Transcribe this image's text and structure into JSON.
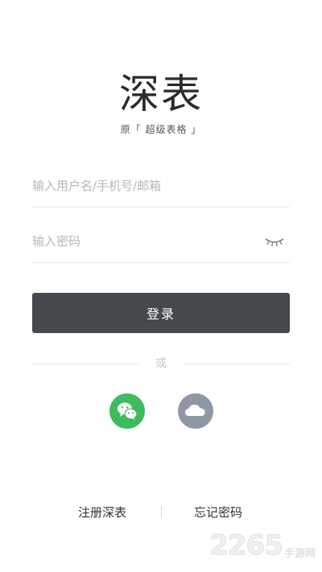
{
  "logo": {
    "mark": "深表",
    "subtitle": "原「 超级表格 」"
  },
  "form": {
    "username_placeholder": "输入用户名/手机号/邮箱",
    "username_value": "",
    "password_placeholder": "输入密码",
    "password_value": "",
    "login_label": "登录"
  },
  "divider": {
    "or_label": "或"
  },
  "social": {
    "wechat_icon": "wechat-icon",
    "cloud_icon": "cloud-icon",
    "wechat_color": "#3dbb5e",
    "cloud_color": "#8f97a6"
  },
  "links": {
    "register": "注册深表",
    "forgot_password": "忘记密码"
  },
  "watermark": {
    "number": "2265",
    "text": "手游网"
  },
  "colors": {
    "button_bg": "#45484d",
    "placeholder": "#b7b7b7"
  }
}
